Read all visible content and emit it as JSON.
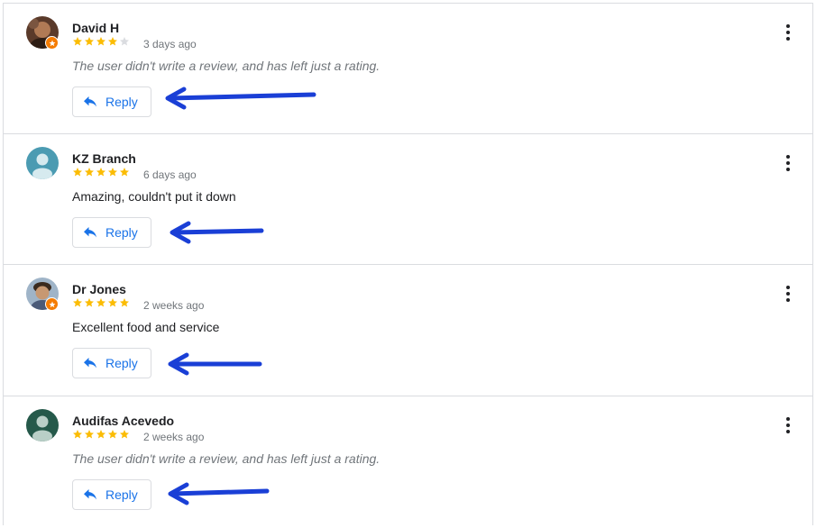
{
  "colors": {
    "star_filled": "#fbbc04",
    "star_empty": "#dadce0",
    "accent": "#1a73e8",
    "annotation_arrow": "#1a3fd6"
  },
  "reviews": [
    {
      "name": "David H",
      "rating": 4,
      "date": "3 days ago",
      "text": "The user didn't write a review, and has left just a rating.",
      "text_style": "italic",
      "avatar_icon": "user-photo-icon",
      "local_guide_badge": true,
      "reply_label": "Reply"
    },
    {
      "name": "KZ Branch",
      "rating": 5,
      "date": "6 days ago",
      "text": "Amazing, couldn't put it down",
      "text_style": "normal",
      "avatar_icon": "default-avatar-icon",
      "local_guide_badge": false,
      "reply_label": "Reply"
    },
    {
      "name": "Dr Jones",
      "rating": 5,
      "date": "2 weeks ago",
      "text": "Excellent food and service",
      "text_style": "normal",
      "avatar_icon": "user-photo-icon",
      "local_guide_badge": true,
      "reply_label": "Reply"
    },
    {
      "name": "Audifas Acevedo",
      "rating": 5,
      "date": "2 weeks ago",
      "text": "The user didn't write a review, and has left just a rating.",
      "text_style": "italic",
      "avatar_icon": "default-avatar-icon",
      "local_guide_badge": false,
      "reply_label": "Reply"
    }
  ]
}
